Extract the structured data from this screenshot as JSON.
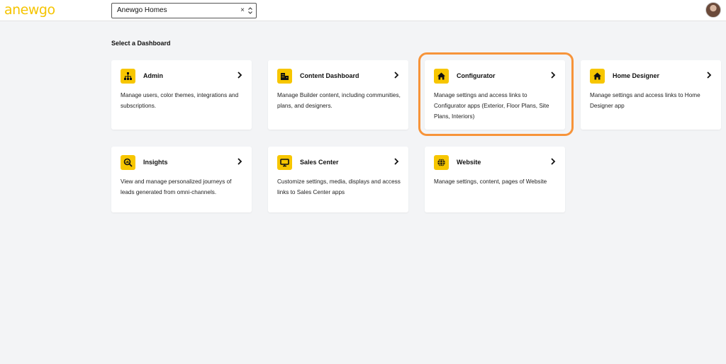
{
  "header": {
    "logo_text": "anewgo",
    "project_select": {
      "value": "Anewgo Homes",
      "clear_label": "×"
    }
  },
  "main": {
    "title": "Select a Dashboard",
    "cards": [
      {
        "title": "Admin",
        "icon": "org-chart-icon",
        "description": "Manage users, color themes, integrations and subscriptions."
      },
      {
        "title": "Content Dashboard",
        "icon": "buildings-icon",
        "description": "Manage Builder content, including communities, plans, and designers."
      },
      {
        "title": "Configurator",
        "icon": "home-icon",
        "description": "Manage settings and access links to Configurator apps (Exterior, Floor Plans, Site Plans, Interiors)"
      },
      {
        "title": "Home Designer",
        "icon": "home-icon",
        "description": "Manage settings and access links to Home Designer app"
      },
      {
        "title": "Insights",
        "icon": "analytics-search-icon",
        "description": "View and manage personalized journeys of leads generated from omni-channels."
      },
      {
        "title": "Sales Center",
        "icon": "monitor-icon",
        "description": "Customize settings, media, displays and access links to Sales Center apps"
      },
      {
        "title": "Website",
        "icon": "globe-icon",
        "description": "Manage settings, content, pages of Website"
      }
    ]
  },
  "colors": {
    "accent": "#f7c600",
    "highlight": "#f7943a",
    "background": "#f3f4f6"
  }
}
